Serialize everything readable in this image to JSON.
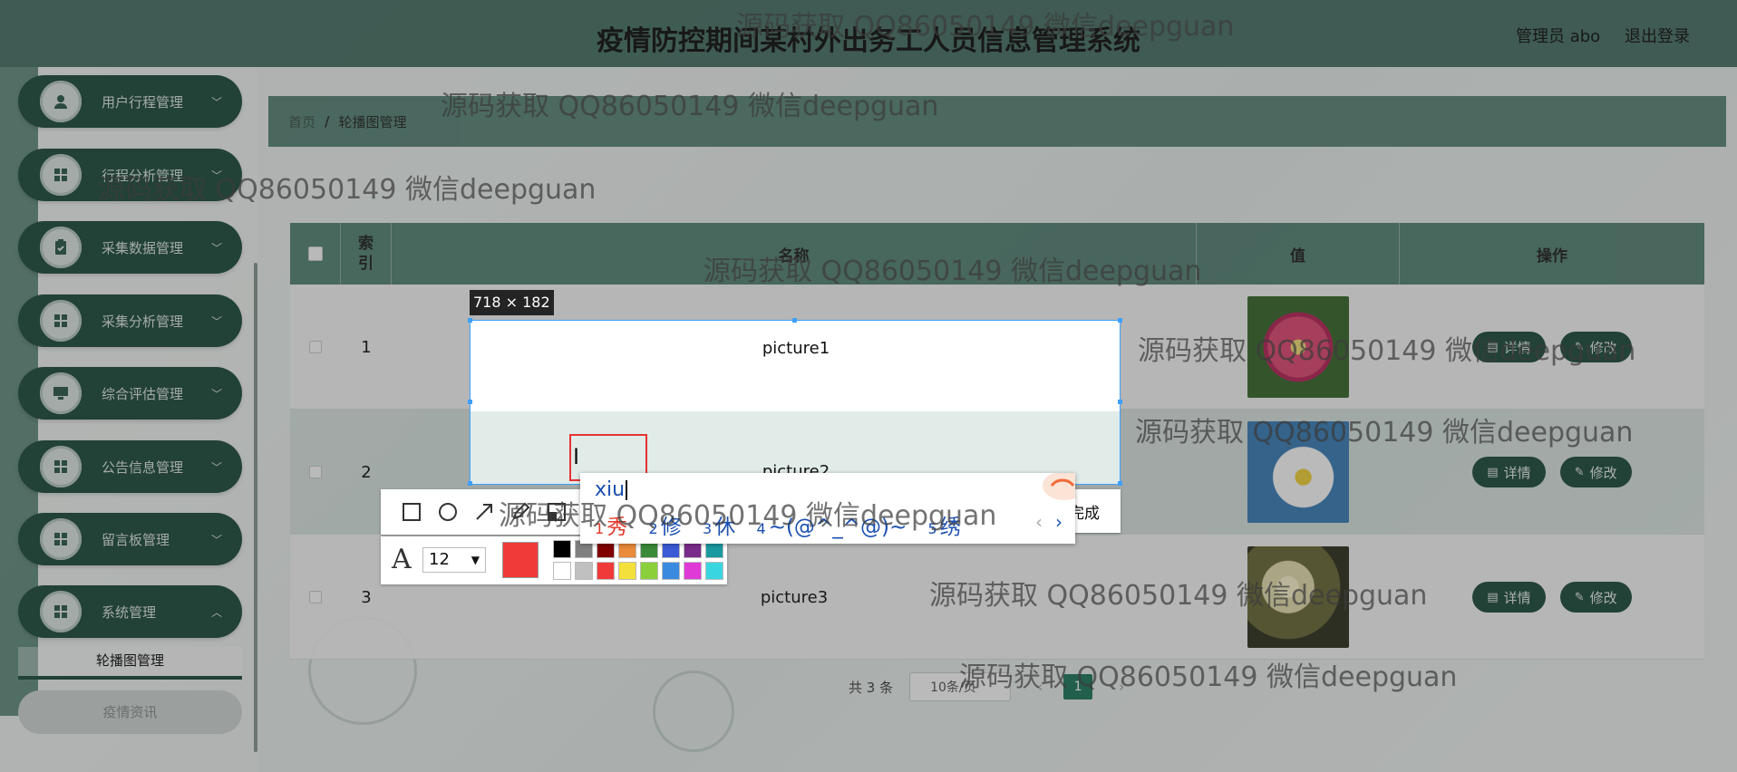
{
  "header": {
    "title": "疫情防控期间某村外出务工人员信息管理系统",
    "user": "管理员 abo",
    "logout": "退出登录"
  },
  "sidebar": {
    "items": [
      {
        "label": "用户行程管理",
        "icon": "user-icon"
      },
      {
        "label": "行程分析管理",
        "icon": "grid-icon"
      },
      {
        "label": "采集数据管理",
        "icon": "clipboard-icon"
      },
      {
        "label": "采集分析管理",
        "icon": "grid-icon"
      },
      {
        "label": "综合评估管理",
        "icon": "monitor-icon"
      },
      {
        "label": "公告信息管理",
        "icon": "grid-icon"
      },
      {
        "label": "留言板管理",
        "icon": "grid-icon"
      },
      {
        "label": "系统管理",
        "icon": "grid-icon"
      }
    ],
    "submenu_active": "轮播图管理",
    "next_item": "疫情资讯"
  },
  "breadcrumb": {
    "home": "首页",
    "sep": "/",
    "current": "轮播图管理"
  },
  "table": {
    "headers": {
      "index": "索\n引",
      "name": "名称",
      "value": "值",
      "actions": "操作"
    },
    "rows": [
      {
        "index": "1",
        "name": "picture1"
      },
      {
        "index": "2",
        "name": "picture2"
      },
      {
        "index": "3",
        "name": "picture3"
      }
    ],
    "btn_detail": "详情",
    "btn_edit": "修改"
  },
  "pager": {
    "total": "共 3 条",
    "size": "10条/页",
    "page": "1"
  },
  "capture": {
    "size_label": "718 × 182",
    "row1_text": "picture1",
    "row2_text": "picture2",
    "done": "完成",
    "font_size": "12",
    "current_color": "#f03a3a",
    "palette_top": [
      "#000000",
      "#808080",
      "#800000",
      "#e98b3a",
      "#3a8a3a",
      "#3a5ad6",
      "#7a2a8a",
      "#1a9aa0"
    ],
    "palette_bottom": [
      "#ffffff",
      "#c0c0c0",
      "#f03a3a",
      "#f3e03a",
      "#8ad03a",
      "#3a8ae0",
      "#e03ad6",
      "#3ad6e0"
    ]
  },
  "ime": {
    "input": "xiu",
    "candidates": [
      {
        "n": "1",
        "text": "秀"
      },
      {
        "n": "2",
        "text": "修"
      },
      {
        "n": "3",
        "text": "休"
      },
      {
        "n": "4",
        "text": "~(@^_^@)~"
      },
      {
        "n": "5",
        "text": "绣"
      }
    ]
  },
  "watermark": "源码获取 QQ86050149 微信deepguan"
}
